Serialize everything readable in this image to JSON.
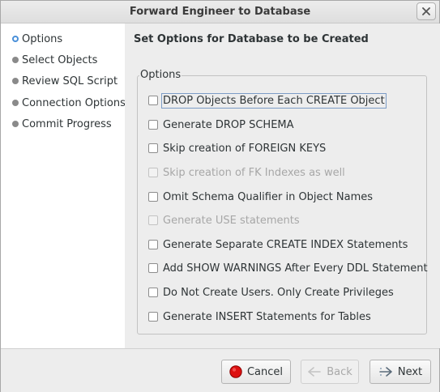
{
  "window": {
    "title": "Forward Engineer to Database"
  },
  "sidebar": {
    "items": [
      {
        "label": "Options",
        "current": true
      },
      {
        "label": "Select Objects",
        "current": false
      },
      {
        "label": "Review SQL Script",
        "current": false
      },
      {
        "label": "Connection Options",
        "current": false
      },
      {
        "label": "Commit Progress",
        "current": false
      }
    ]
  },
  "main": {
    "heading": "Set Options for Database to be Created",
    "group_label": "Options",
    "options": [
      {
        "label": "DROP Objects Before Each CREATE Object",
        "checked": false,
        "enabled": true,
        "focused": true
      },
      {
        "label": "Generate DROP SCHEMA",
        "checked": false,
        "enabled": true
      },
      {
        "label": "Skip creation of FOREIGN KEYS",
        "checked": false,
        "enabled": true
      },
      {
        "label": "Skip creation of FK Indexes as well",
        "checked": false,
        "enabled": false
      },
      {
        "label": "Omit Schema Qualifier in Object Names",
        "checked": false,
        "enabled": true
      },
      {
        "label": "Generate USE statements",
        "checked": false,
        "enabled": false
      },
      {
        "label": "Generate Separate CREATE INDEX Statements",
        "checked": false,
        "enabled": true
      },
      {
        "label": "Add SHOW WARNINGS After Every DDL Statement",
        "checked": false,
        "enabled": true
      },
      {
        "label": "Do Not Create Users. Only Create Privileges",
        "checked": false,
        "enabled": true
      },
      {
        "label": "Generate INSERT Statements for Tables",
        "checked": false,
        "enabled": true
      }
    ]
  },
  "footer": {
    "cancel_label": "Cancel",
    "back_label": "Back",
    "next_label": "Next"
  }
}
